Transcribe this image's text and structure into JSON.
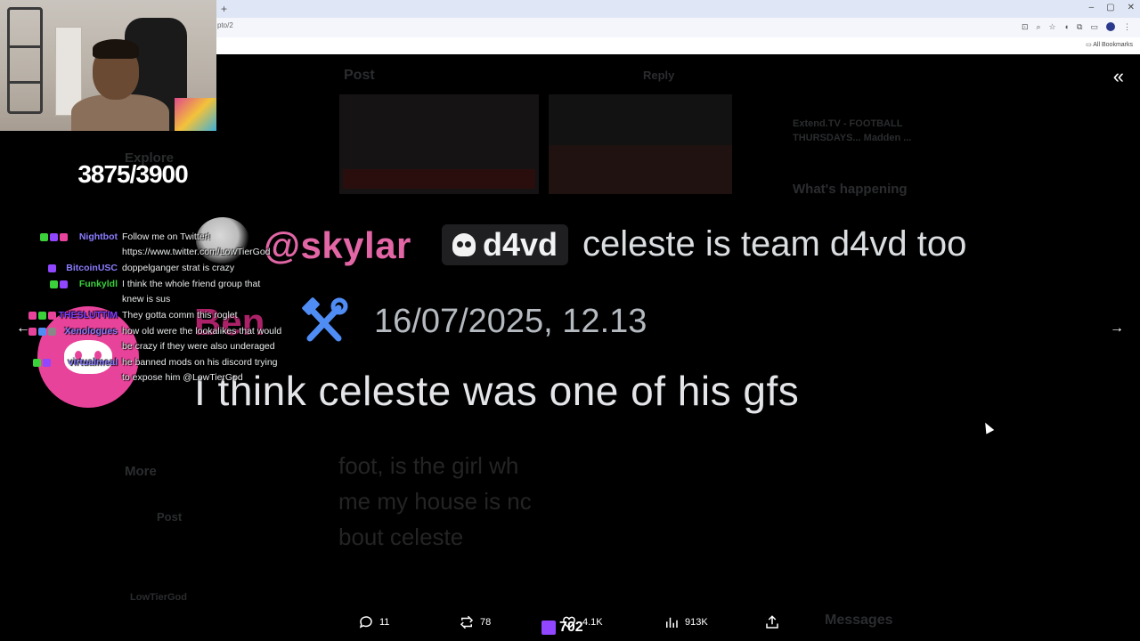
{
  "browser": {
    "url": "pto/2",
    "new_tab_glyph": "+",
    "window_controls": [
      "–",
      "▢",
      "✕"
    ],
    "bookmarks_label": "All Bookmarks"
  },
  "page": {
    "header_title": "Post",
    "reply_label": "Reply",
    "nav_explore": "Explore",
    "nav_more": "More",
    "post_button": "Post",
    "sidebar_heading": "What's happening",
    "trend_text": "Extend.TV - FOOTBALL THURSDAYS... Madden ...",
    "messages_label": "Messages",
    "account_name": "LowTierGod",
    "tweet_text_lines": [
      "foot, is the girl wh",
      "me my house is nc",
      "bout celeste"
    ]
  },
  "media": {
    "mention": "@skylar",
    "server_tag": "d4vd",
    "reply_preview": "celeste is team d4vd too",
    "author": "Ben",
    "timestamp": "16/07/2025, 12.13",
    "message": "I think celeste was one of his gfs"
  },
  "viewer": {
    "collapse_icon": "«",
    "prev_icon": "←",
    "next_icon": "→"
  },
  "stream": {
    "sub_counter": "3875/3900"
  },
  "chat": [
    {
      "user": "Nightbot",
      "color": "#8a7cff",
      "message": "Follow me on Twitter!"
    },
    {
      "user": "",
      "color": "#ffffff",
      "message": "https://www.twitter.com/LowTierGod"
    },
    {
      "user": "BitcoinUSC",
      "color": "#8a7cff",
      "message": "doppelganger strat is crazy"
    },
    {
      "user": "Funkyldl",
      "color": "#3bd13b",
      "message": "I think the whole friend group that"
    },
    {
      "user": "",
      "color": "#ffffff",
      "message": "knew is sus"
    },
    {
      "user": "THESLUTTIM",
      "color": "#7a3cff",
      "message": "They gotta comm this roglet"
    },
    {
      "user": "Xenologues",
      "color": "#8a7cff",
      "message": "how old were the lookalikes that would"
    },
    {
      "user": "",
      "color": "#ffffff",
      "message": "be crazy if they were also underaged"
    },
    {
      "user": "virtualmeal",
      "color": "#8a7cff",
      "message": "he banned mods on his discord trying"
    },
    {
      "user": "",
      "color": "#ffffff",
      "message": "to expose him @LowTierGod"
    }
  ],
  "actions": {
    "replies": "11",
    "reposts": "78",
    "likes": "4.1K",
    "views": "913K",
    "overlay_count": "702"
  }
}
